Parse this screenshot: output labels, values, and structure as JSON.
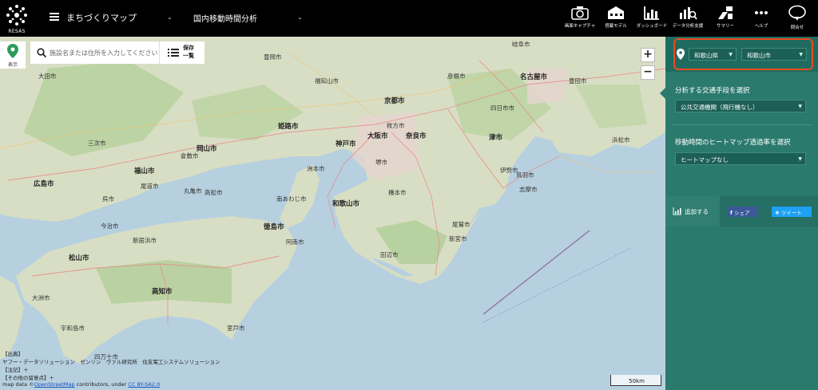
{
  "header": {
    "logo_text": "RESAS",
    "menu_title": "まちづくりマップ",
    "analysis_title": "国内移動時間分析",
    "tools": [
      {
        "label": "画面キャプチャ",
        "icon": "camera-icon"
      },
      {
        "label": "搭載モデル",
        "icon": "model-icon"
      },
      {
        "label": "ダッシュボード",
        "icon": "dashboard-icon"
      },
      {
        "label": "データ分析支援",
        "icon": "analysis-icon"
      },
      {
        "label": "サマリー",
        "icon": "summary-icon"
      },
      {
        "label": "ヘルプ",
        "icon": "more-icon"
      },
      {
        "label": "問合せ",
        "icon": "chat-icon"
      }
    ]
  },
  "map": {
    "pin_label": "表示",
    "search_placeholder": "施設名または住所を入力してください",
    "saved_label_line1": "保存",
    "saved_label_line2": "一覧",
    "zoom_in": "+",
    "zoom_out": "−",
    "scale_label": "50km",
    "credits": {
      "source_title": "【出典】",
      "source_text": "ヤフー・データソリューション　ゼンリン　ヴァル研究所　住友電工システムソリューション",
      "note": "【注記】＋",
      "other_note": "【その他の留意点】＋",
      "osm_prefix": "map data ©",
      "osm_link": "OpenStreetMap",
      "osm_middle": " contributors, under ",
      "license_link": "CC BY-SA2.0"
    },
    "places": [
      {
        "name": "京都市",
        "big": true
      },
      {
        "name": "大阪市",
        "big": true
      },
      {
        "name": "神戸市",
        "big": true
      },
      {
        "name": "奈良市",
        "big": true
      },
      {
        "name": "和歌山市",
        "big": true
      },
      {
        "name": "名古屋市",
        "big": true
      },
      {
        "name": "岡山市",
        "big": true
      },
      {
        "name": "姫路市",
        "big": true
      },
      {
        "name": "徳島市",
        "big": true
      },
      {
        "name": "高知市",
        "big": true
      },
      {
        "name": "松山市",
        "big": true
      },
      {
        "name": "広島市",
        "big": true
      },
      {
        "name": "福山市",
        "big": true
      },
      {
        "name": "津市",
        "big": true
      },
      {
        "name": "豊田市",
        "big": false
      },
      {
        "name": "浜松市",
        "big": false
      },
      {
        "name": "堺市",
        "big": false
      },
      {
        "name": "枚方市",
        "big": false
      },
      {
        "name": "岐阜市",
        "big": false
      },
      {
        "name": "大田市",
        "big": false
      },
      {
        "name": "三次市",
        "big": false
      },
      {
        "name": "倉敷市",
        "big": false
      },
      {
        "name": "今治市",
        "big": false
      },
      {
        "name": "新居浜市",
        "big": false
      },
      {
        "name": "丸亀市",
        "big": false
      },
      {
        "name": "洲本市",
        "big": false
      },
      {
        "name": "南あわじ市",
        "big": false
      },
      {
        "name": "阿南市",
        "big": false
      },
      {
        "name": "田辺市",
        "big": false
      },
      {
        "name": "新宮市",
        "big": false
      },
      {
        "name": "尾鷲市",
        "big": false
      },
      {
        "name": "鳥羽市",
        "big": false
      },
      {
        "name": "志摩市",
        "big": false
      },
      {
        "name": "伊勢市",
        "big": false
      },
      {
        "name": "四万十市",
        "big": false
      },
      {
        "name": "宇和島市",
        "big": false
      },
      {
        "name": "室戸市",
        "big": false
      },
      {
        "name": "大洲市",
        "big": false
      },
      {
        "name": "橋本市",
        "big": false
      },
      {
        "name": "豊岡市",
        "big": false
      },
      {
        "name": "福知山市",
        "big": false
      },
      {
        "name": "彦根市",
        "big": false
      },
      {
        "name": "四日市市",
        "big": false
      },
      {
        "name": "呉市",
        "big": false
      },
      {
        "name": "尾道市",
        "big": false
      },
      {
        "name": "高松市",
        "big": false
      }
    ]
  },
  "panel": {
    "prefecture": "和歌山県",
    "city": "和歌山市",
    "transport_label": "分析する交通手段を選択",
    "transport_value": "公共交通機関（飛行機なし）",
    "heatmap_label": "移動時間のヒートマップ透過率を選択",
    "heatmap_value": "ヒートマップなし",
    "add_label": "追加する",
    "share_label": "シェア",
    "tweet_label": "ツイート"
  },
  "colors": {
    "panel_bg": "#2b7a6e",
    "highlight": "#ef4a1f",
    "sea": "#b6d0e0",
    "land": "#d9dfc4",
    "forest": "#b5cf9e"
  }
}
